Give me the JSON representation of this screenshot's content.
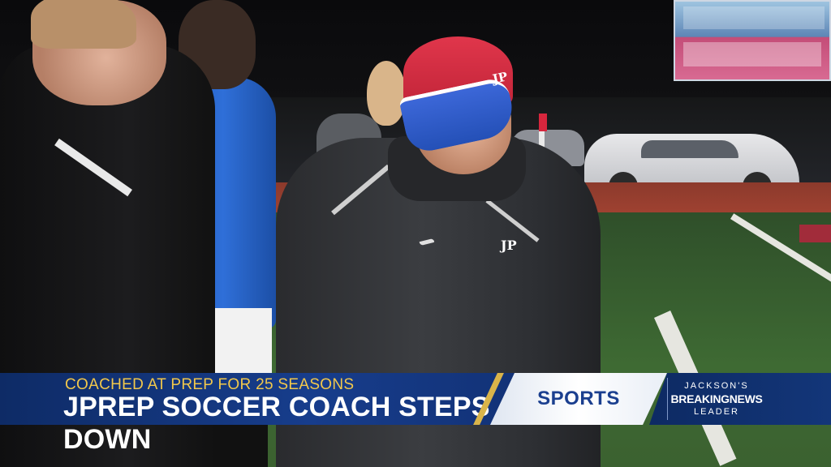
{
  "scene": {
    "beanie_logo": "JP",
    "jacket_logo": "JP"
  },
  "lower_third": {
    "subheadline": "COACHED AT PREP FOR 25 SEASONS",
    "headline": "JPREP SOCCER COACH STEPS DOWN",
    "section": "SPORTS",
    "brand": {
      "line1": "JACKSON'S",
      "line2": "BREAKINGNEWS",
      "line3": "LEADER"
    },
    "colors": {
      "banner_blue": "#173d8c",
      "subheadline_gold": "#f2c84b",
      "section_text": "#1b3f8f"
    }
  }
}
